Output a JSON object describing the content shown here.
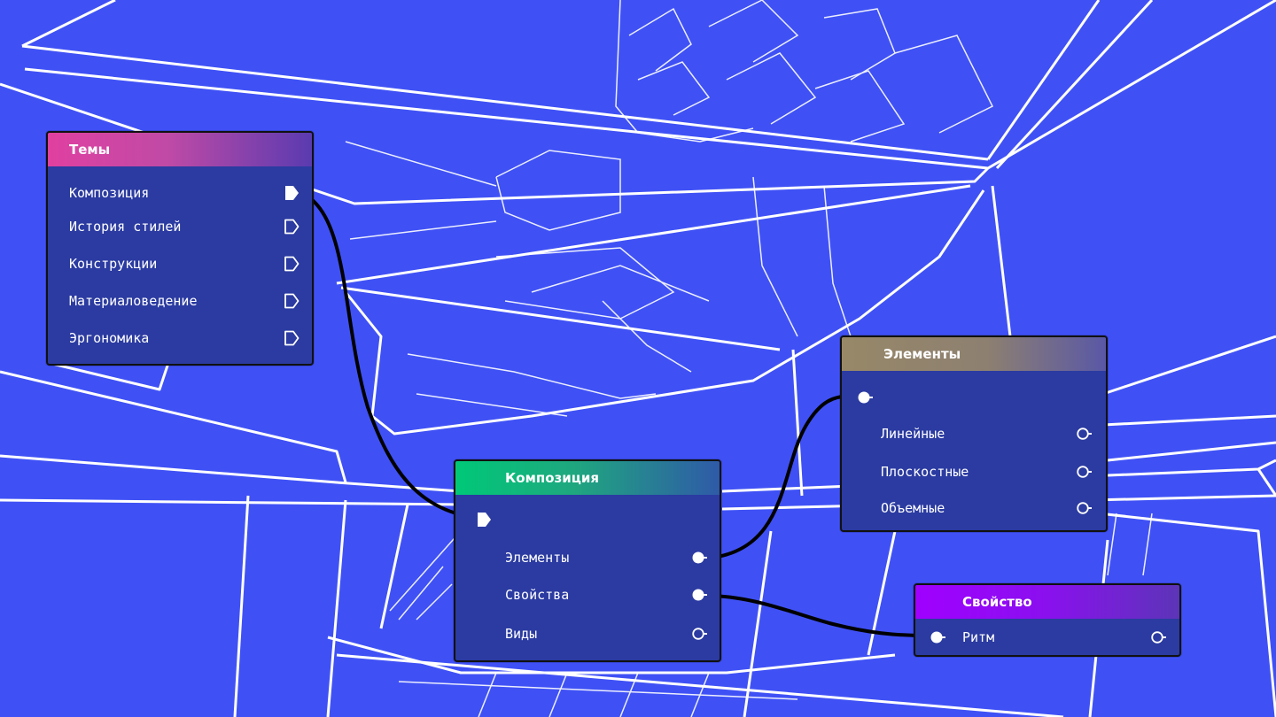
{
  "colors": {
    "background": "#3f51f5",
    "node_body": "#2b3ba1",
    "wire": "#000000",
    "lines": "#ffffff"
  },
  "nodes": {
    "temy": {
      "title": "Темы",
      "header_gradient": [
        "#e040a0",
        "#5a3bb0"
      ],
      "items": [
        "Композиция",
        "История стилей",
        "Конструкции",
        "Материаловедение",
        "Эргономика"
      ]
    },
    "kompoziciya": {
      "title": "Композиция",
      "header_gradient": [
        "#00c878",
        "#2f5aa8"
      ],
      "items": [
        "Элементы",
        "Свойства",
        "Виды"
      ]
    },
    "elementy": {
      "title": "Элементы",
      "header_gradient": [
        "#9a8a66",
        "#5a58a6"
      ],
      "items": [
        "Линейные",
        "Плоскостные",
        "Объемные"
      ]
    },
    "svoistvo": {
      "title": "Свойство",
      "header_gradient": [
        "#a000ff",
        "#5c35b8"
      ],
      "items": [
        "Ритм"
      ]
    }
  }
}
